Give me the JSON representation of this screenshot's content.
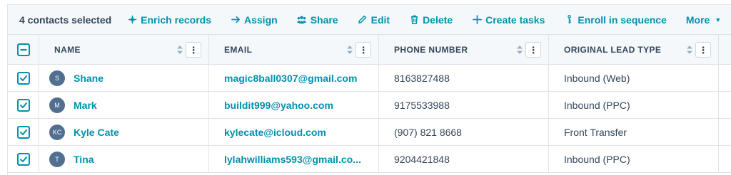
{
  "bulk_actions": {
    "selected_text": "4 contacts selected",
    "enrich": "Enrich records",
    "assign": "Assign",
    "share": "Share",
    "edit": "Edit",
    "delete": "Delete",
    "create_tasks": "Create tasks",
    "enroll": "Enroll in sequence",
    "more": "More"
  },
  "columns": {
    "name": "NAME",
    "email": "EMAIL",
    "phone": "PHONE NUMBER",
    "lead_type": "ORIGINAL LEAD TYPE"
  },
  "rows": [
    {
      "initials": "S",
      "name": "Shane",
      "email": "magic8ball0307@gmail.com",
      "phone": "8163827488",
      "lead_type": "Inbound (Web)",
      "checked": true
    },
    {
      "initials": "M",
      "name": "Mark",
      "email": "buildit999@yahoo.com",
      "phone": "9175533988",
      "lead_type": "Inbound (PPC)",
      "checked": true
    },
    {
      "initials": "KC",
      "name": "Kyle Cate",
      "email": "kylecate@icloud.com",
      "phone": "(907) 821 8668",
      "lead_type": "Front Transfer",
      "checked": true
    },
    {
      "initials": "T",
      "name": "Tina",
      "email": "lylahwilliams593@gmail.co...",
      "phone": "9204421848",
      "lead_type": "Inbound (PPC)",
      "checked": true
    }
  ],
  "colors": {
    "accent": "#0091ae",
    "text": "#33475b",
    "border": "#dfe3eb",
    "header_bg": "#f5f8fa",
    "avatar": "#516f90"
  }
}
